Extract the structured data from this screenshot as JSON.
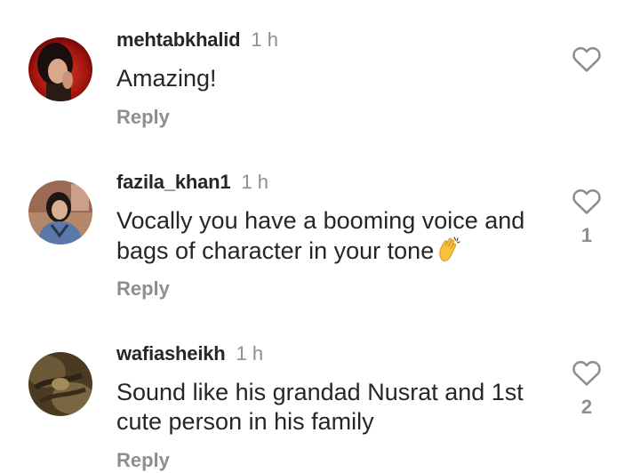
{
  "comments": [
    {
      "username": "mehtabkhalid",
      "time": "1 h",
      "text": "Amazing!",
      "reply_label": "Reply",
      "likes": ""
    },
    {
      "username": "fazila_khan1",
      "time": "1 h",
      "text": "Vocally you have a booming voice and bags of character in your tone",
      "emoji": "clapping-hands-emoji",
      "reply_label": "Reply",
      "likes": "1"
    },
    {
      "username": "wafiasheikh",
      "time": "1 h",
      "text": "Sound like his grandad Nusrat and 1st cute person in his family",
      "reply_label": "Reply",
      "likes": "2"
    }
  ],
  "icons": {
    "like": "heart-outline-icon"
  },
  "colors": {
    "primary_text": "#262626",
    "secondary_text": "#8e8e8e",
    "background": "#ffffff"
  }
}
